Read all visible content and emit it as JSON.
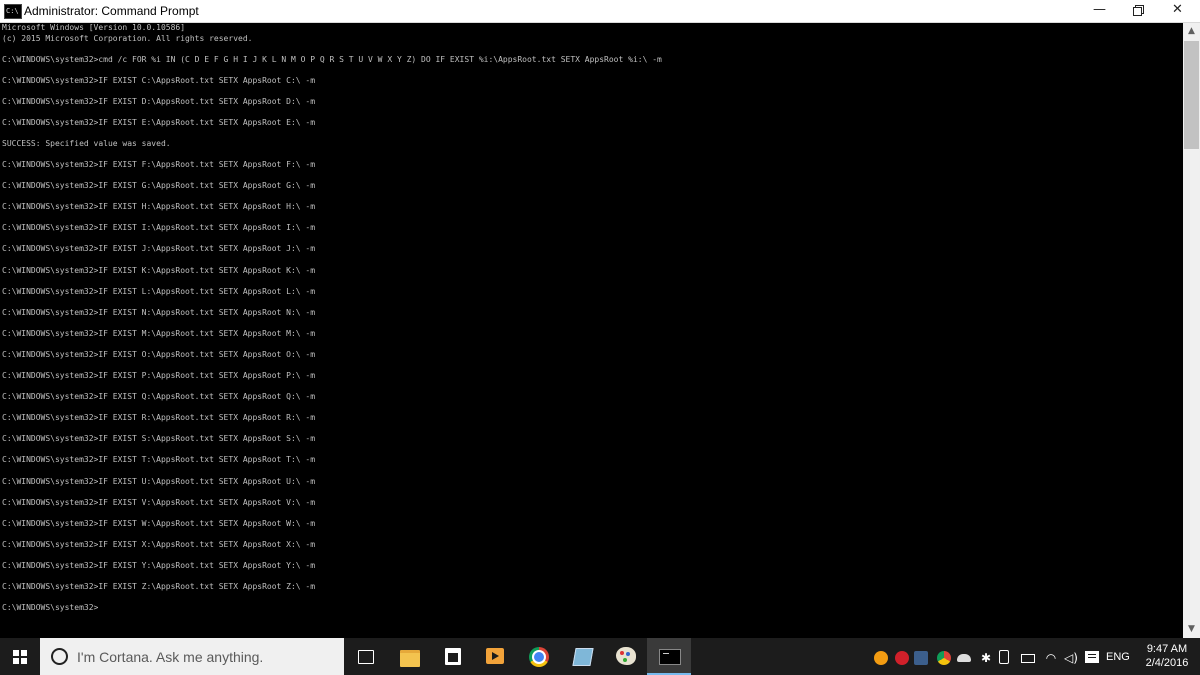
{
  "window": {
    "title": "Administrator: Command Prompt",
    "buttons": {
      "minimize": "—",
      "close": "✕"
    }
  },
  "console": {
    "lines": [
      "Microsoft Windows [Version 10.0.10586]",
      "(c) 2015 Microsoft Corporation. All rights reserved.",
      "",
      "C:\\WINDOWS\\system32>cmd /c FOR %i IN (C D E F G H I J K L N M O P Q R S T U V W X Y Z) DO IF EXIST %i:\\AppsRoot.txt SETX AppsRoot %i:\\ -m",
      "",
      "C:\\WINDOWS\\system32>IF EXIST C:\\AppsRoot.txt SETX AppsRoot C:\\ -m",
      "",
      "C:\\WINDOWS\\system32>IF EXIST D:\\AppsRoot.txt SETX AppsRoot D:\\ -m",
      "",
      "C:\\WINDOWS\\system32>IF EXIST E:\\AppsRoot.txt SETX AppsRoot E:\\ -m",
      "",
      "SUCCESS: Specified value was saved.",
      "",
      "C:\\WINDOWS\\system32>IF EXIST F:\\AppsRoot.txt SETX AppsRoot F:\\ -m",
      "",
      "C:\\WINDOWS\\system32>IF EXIST G:\\AppsRoot.txt SETX AppsRoot G:\\ -m",
      "",
      "C:\\WINDOWS\\system32>IF EXIST H:\\AppsRoot.txt SETX AppsRoot H:\\ -m",
      "",
      "C:\\WINDOWS\\system32>IF EXIST I:\\AppsRoot.txt SETX AppsRoot I:\\ -m",
      "",
      "C:\\WINDOWS\\system32>IF EXIST J:\\AppsRoot.txt SETX AppsRoot J:\\ -m",
      "",
      "C:\\WINDOWS\\system32>IF EXIST K:\\AppsRoot.txt SETX AppsRoot K:\\ -m",
      "",
      "C:\\WINDOWS\\system32>IF EXIST L:\\AppsRoot.txt SETX AppsRoot L:\\ -m",
      "",
      "C:\\WINDOWS\\system32>IF EXIST N:\\AppsRoot.txt SETX AppsRoot N:\\ -m",
      "",
      "C:\\WINDOWS\\system32>IF EXIST M:\\AppsRoot.txt SETX AppsRoot M:\\ -m",
      "",
      "C:\\WINDOWS\\system32>IF EXIST O:\\AppsRoot.txt SETX AppsRoot O:\\ -m",
      "",
      "C:\\WINDOWS\\system32>IF EXIST P:\\AppsRoot.txt SETX AppsRoot P:\\ -m",
      "",
      "C:\\WINDOWS\\system32>IF EXIST Q:\\AppsRoot.txt SETX AppsRoot Q:\\ -m",
      "",
      "C:\\WINDOWS\\system32>IF EXIST R:\\AppsRoot.txt SETX AppsRoot R:\\ -m",
      "",
      "C:\\WINDOWS\\system32>IF EXIST S:\\AppsRoot.txt SETX AppsRoot S:\\ -m",
      "",
      "C:\\WINDOWS\\system32>IF EXIST T:\\AppsRoot.txt SETX AppsRoot T:\\ -m",
      "",
      "C:\\WINDOWS\\system32>IF EXIST U:\\AppsRoot.txt SETX AppsRoot U:\\ -m",
      "",
      "C:\\WINDOWS\\system32>IF EXIST V:\\AppsRoot.txt SETX AppsRoot V:\\ -m",
      "",
      "C:\\WINDOWS\\system32>IF EXIST W:\\AppsRoot.txt SETX AppsRoot W:\\ -m",
      "",
      "C:\\WINDOWS\\system32>IF EXIST X:\\AppsRoot.txt SETX AppsRoot X:\\ -m",
      "",
      "C:\\WINDOWS\\system32>IF EXIST Y:\\AppsRoot.txt SETX AppsRoot Y:\\ -m",
      "",
      "C:\\WINDOWS\\system32>IF EXIST Z:\\AppsRoot.txt SETX AppsRoot Z:\\ -m",
      "",
      "C:\\WINDOWS\\system32>"
    ]
  },
  "taskbar": {
    "search_placeholder": "I'm Cortana. Ask me anything.",
    "apps": [
      "task-view",
      "file-explorer",
      "store",
      "media-player",
      "chrome",
      "notes",
      "paint",
      "command-prompt"
    ],
    "active_app": "command-prompt",
    "tray": {
      "language": "ENG",
      "time": "9:47 AM",
      "date": "2/4/2016"
    }
  },
  "colors": {
    "console_bg": "#000000",
    "console_text": "#c0c0c0",
    "taskbar_bg": "#1c1c1c",
    "active_indicator": "#76b9ed"
  }
}
